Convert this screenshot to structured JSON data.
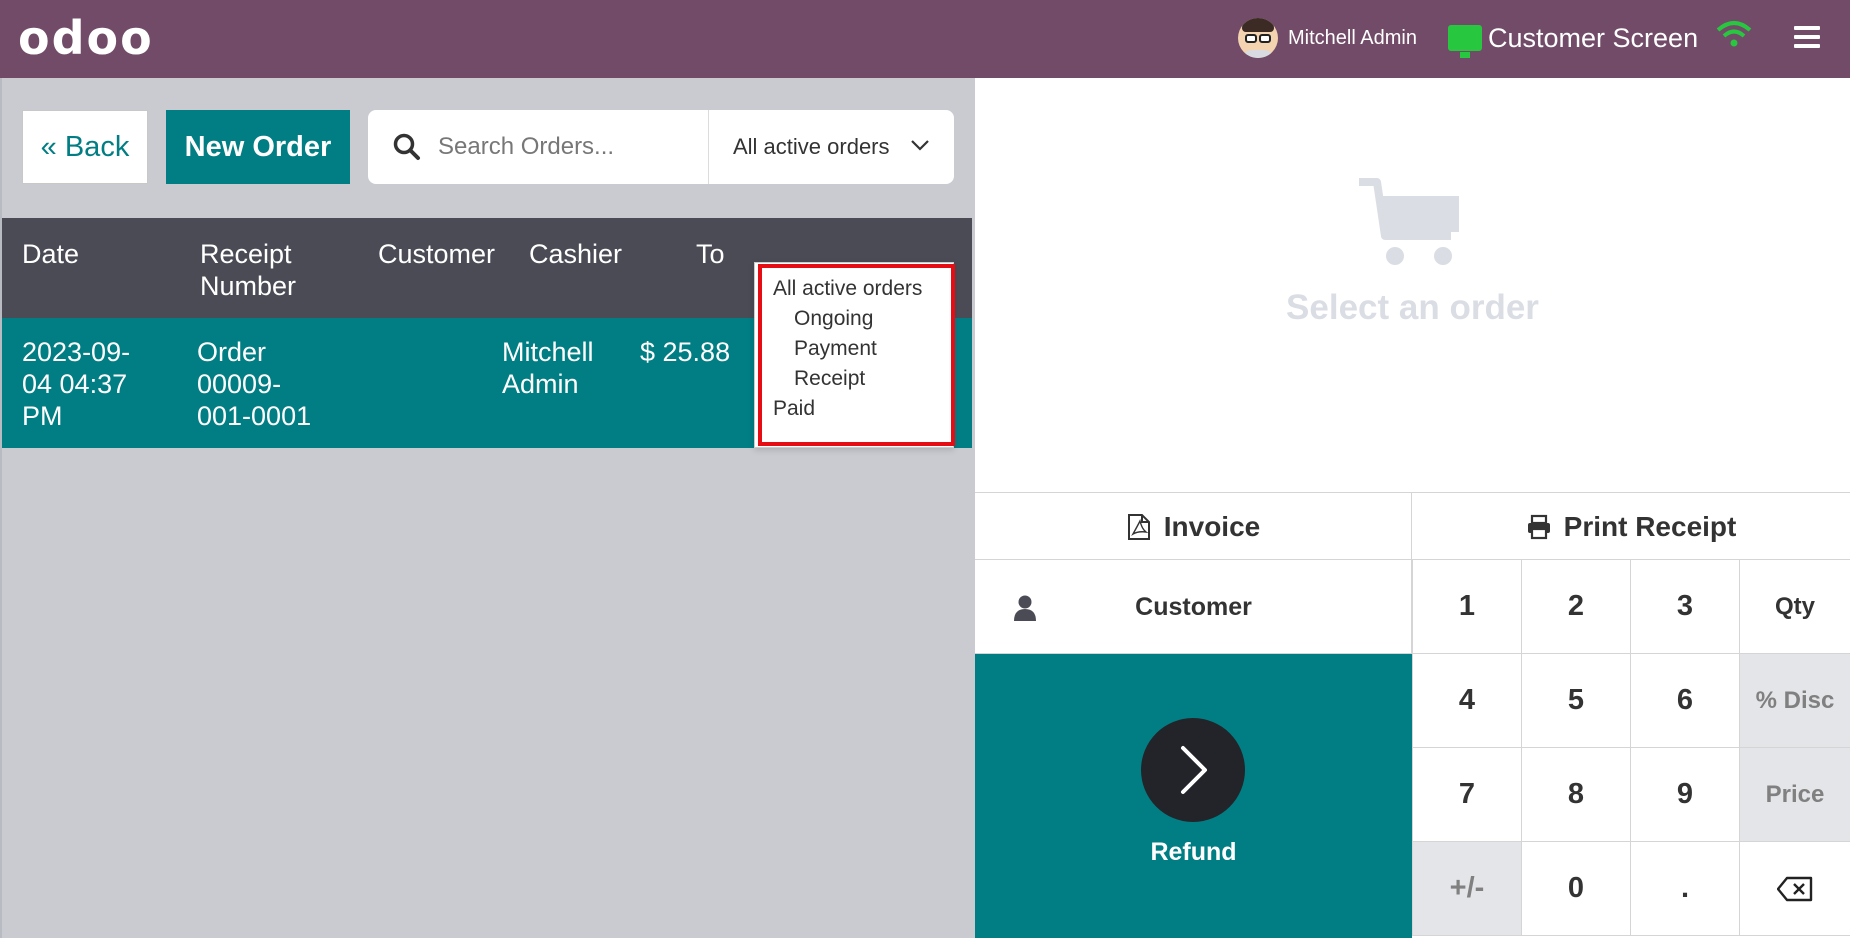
{
  "header": {
    "logo": "odoo",
    "user_name": "Mitchell Admin",
    "customer_screen_label": "Customer Screen"
  },
  "toolbar": {
    "back_label": "« Back",
    "new_order_label": "New Order",
    "search_placeholder": "Search Orders...",
    "filter_selected": "All active orders"
  },
  "filter_menu": {
    "items": [
      "All active orders",
      "Ongoing",
      "Payment",
      "Receipt",
      "Paid"
    ]
  },
  "table": {
    "columns": [
      "Date",
      "Receipt\nNumber",
      "Customer",
      "Cashier",
      "To"
    ],
    "rows": [
      {
        "date": "2023-09-\n04 04:37\nPM",
        "receipt": "Order\n00009-\n001-0001",
        "customer": "",
        "cashier": "Mitchell\nAdmin",
        "total": "$ 25.88"
      }
    ]
  },
  "right_panel": {
    "empty_message": "Select an order",
    "invoice_label": "Invoice",
    "print_label": "Print Receipt",
    "customer_label": "Customer",
    "refund_label": "Refund"
  },
  "numpad": {
    "keys": [
      "1",
      "2",
      "3",
      "Qty",
      "4",
      "5",
      "6",
      "% Disc",
      "7",
      "8",
      "9",
      "Price",
      "+/-",
      "0",
      "."
    ]
  },
  "colors": {
    "header_bg": "#714b67",
    "teal": "#017e84",
    "table_header_bg": "#4a4b55",
    "highlight_red": "#e50c14",
    "wifi_green": "#28c740"
  }
}
